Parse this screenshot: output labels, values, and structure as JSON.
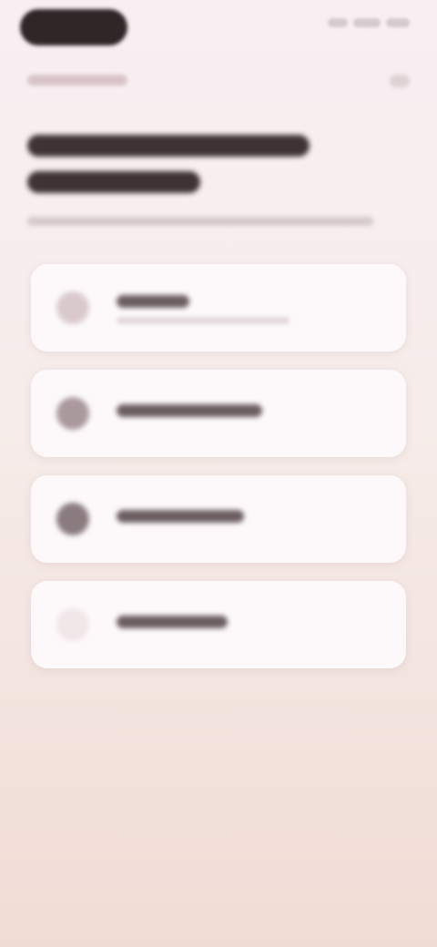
{
  "status_bar": {
    "pill_color": "#2f2727"
  },
  "nav": {
    "back_icon": "chevron-left-icon",
    "menu_icon": "more-icon"
  },
  "title": {
    "color": "#3f3335"
  },
  "options": [
    {
      "icon": "option-icon",
      "icon_color": "#d9c9cc",
      "has_sub": true
    },
    {
      "icon": "option-icon",
      "icon_color": "#a9999d",
      "has_sub": false
    },
    {
      "icon": "option-icon",
      "icon_color": "#8a7b7f",
      "has_sub": false
    },
    {
      "icon": "option-icon",
      "icon_color": "#f1e6e8",
      "has_sub": false
    }
  ],
  "colors": {
    "background_top": "#f8eff3",
    "background_bottom": "#f1dcd5",
    "card": "#fdf9fb",
    "text_dark": "#3a2e30"
  }
}
